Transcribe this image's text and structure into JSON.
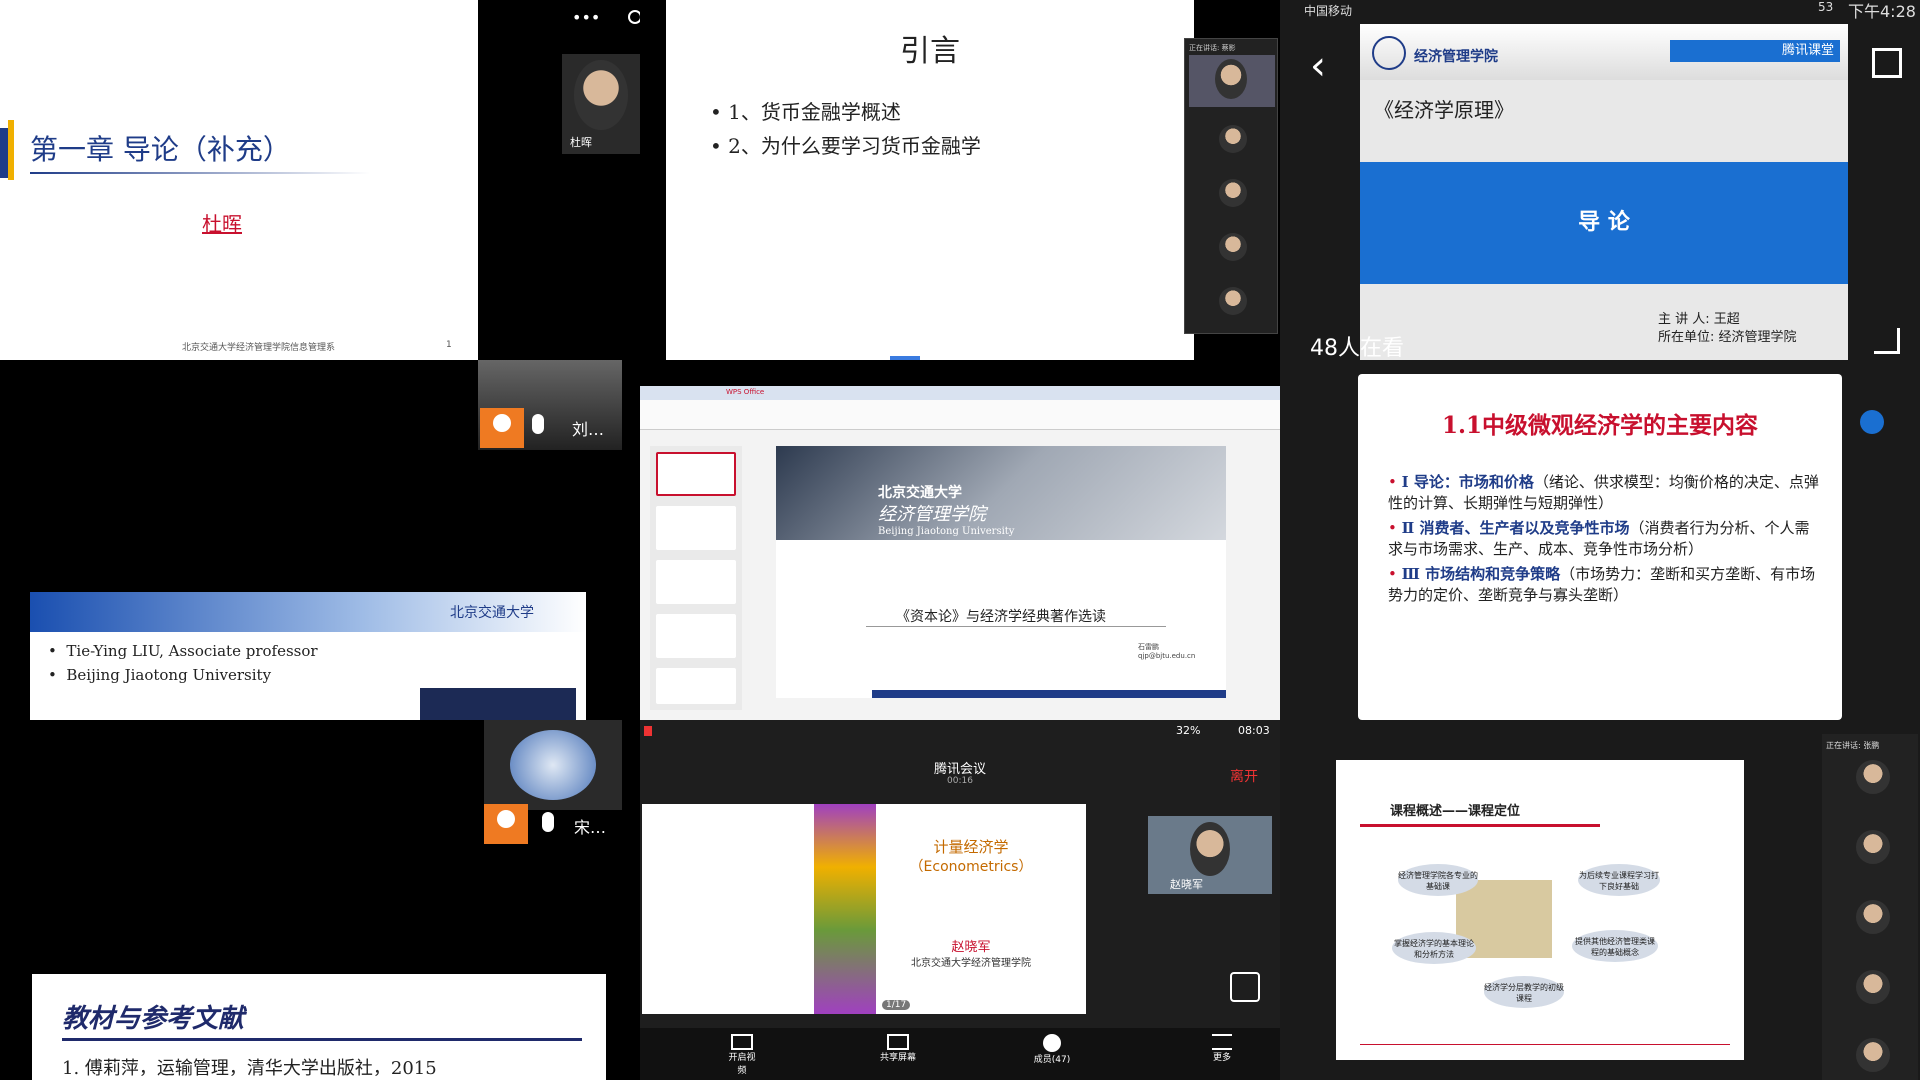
{
  "c1": {
    "title": "第一章 导论（补充）",
    "author": "杜晖",
    "footer": "北京交通大学经济管理学院信息管理系",
    "page": "1",
    "cam_name": "杜晖"
  },
  "c2": {
    "title": "引言",
    "items": [
      "1、货币金融学概述",
      "2、为什么要学习货币金融学"
    ],
    "panel_title": "正在讲话: 蔡影"
  },
  "c3": {
    "carrier": "中国移动",
    "battery": "53",
    "time": "下午4:28",
    "course": "《经济学原理》",
    "banner": "导 论",
    "lecturer": "主 讲 人:  王超",
    "unit": "所在单位:  经济管理学院",
    "viewers": "48人在看",
    "logo_text": "经济管理学院",
    "brand": "腾讯课堂"
  },
  "c4": {
    "name": "刘…",
    "line1": "Tie-Ying LIU, Associate professor",
    "line2": "Beijing Jiaotong University",
    "logo": "北京交通大学"
  },
  "c5": {
    "uni_cn": "北京交通大学",
    "school_cn": "经济管理学院",
    "uni_en": "Beijing Jiaotong University",
    "subtitle": "《资本论》与经济学经典著作选读",
    "contact_name": "石雷鹏",
    "contact_email": "qjp@bjtu.edu.cn",
    "app_tab": "WPS Office"
  },
  "c6": {
    "title": "1.1中级微观经济学的主要内容",
    "items": [
      {
        "head": "Ⅰ 导论：市场和价格",
        "body": "（绪论、供求模型：均衡价格的决定、点弹性的计算、长期弹性与短期弹性）"
      },
      {
        "head": "Ⅱ 消费者、生产者以及竞争性市场",
        "body": "（消费者行为分析、个人需求与市场需求、生产、成本、竞争性市场分析）"
      },
      {
        "head": "Ⅲ 市场结构和竞争策略",
        "body": "（市场势力：垄断和买方垄断、有市场势力的定价、垄断竞争与寡头垄断）"
      }
    ]
  },
  "c7": {
    "name": "宋…",
    "title": "教材与参考文献",
    "ref1": "1. 傅莉萍，运输管理，清华大学出版社，2015"
  },
  "c8": {
    "battery": "32%",
    "time": "08:03",
    "app": "腾讯会议",
    "duration": "00:16",
    "leave": "离开",
    "title_cn": "计量经济学",
    "title_en": "（Econometrics）",
    "teacher": "赵晓军",
    "school": "北京交通大学经济管理学院",
    "page": "1/17",
    "cam_name": "赵晓军",
    "toolbar": [
      "开启视频",
      "共享屏幕",
      "成员(47)",
      "更多"
    ]
  },
  "c9": {
    "title": "课程概述——课程定位",
    "bubbles": [
      "经济管理学院各专业的基础课",
      "为后续专业课程学习打下良好基础",
      "掌握经济学的基本理论和分析方法",
      "提供其他经济管理类课程的基础概念",
      "经济学分层教学的初级课程"
    ],
    "panel_title": "正在讲话: 张鹏"
  },
  "colors": {
    "accent_blue": "#1a6fd1",
    "red": "#c8102e",
    "navy": "#1f2a6b"
  }
}
